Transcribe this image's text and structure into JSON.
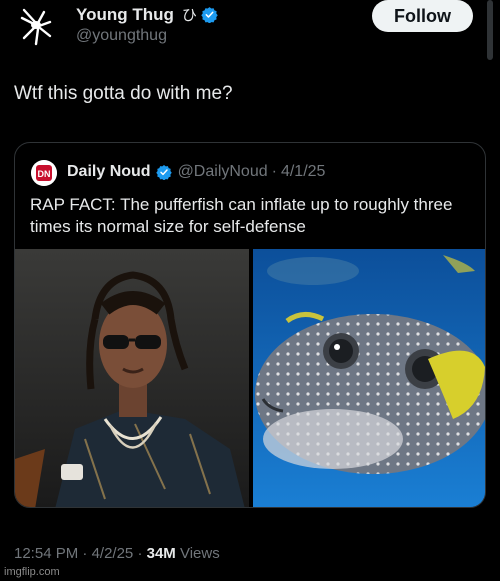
{
  "author": {
    "display_name": "Young Thug",
    "name_glyph": "ひ",
    "handle": "@youngthug",
    "verified_color": "#1d9bf0",
    "avatar_icon": "spider-logo-icon"
  },
  "follow_button_label": "Follow",
  "tweet_text": "Wtf this gotta do with me?",
  "quote": {
    "display_name": "Daily Noud",
    "handle": "@DailyNoud",
    "separator": "·",
    "date": "4/1/25",
    "avatar_icon": "daily-noud-logo-icon",
    "avatar_text": "DN",
    "text": "RAP FACT: The pufferfish can inflate up to roughly three times its normal size for self-defense",
    "images": [
      "photo-rapper",
      "photo-pufferfish"
    ]
  },
  "meta": {
    "time": "12:54 PM",
    "sep1": "·",
    "date": "4/2/25",
    "sep2": "·",
    "views_count": "34M",
    "views_label": "Views"
  },
  "watermark": "imgflip.com"
}
